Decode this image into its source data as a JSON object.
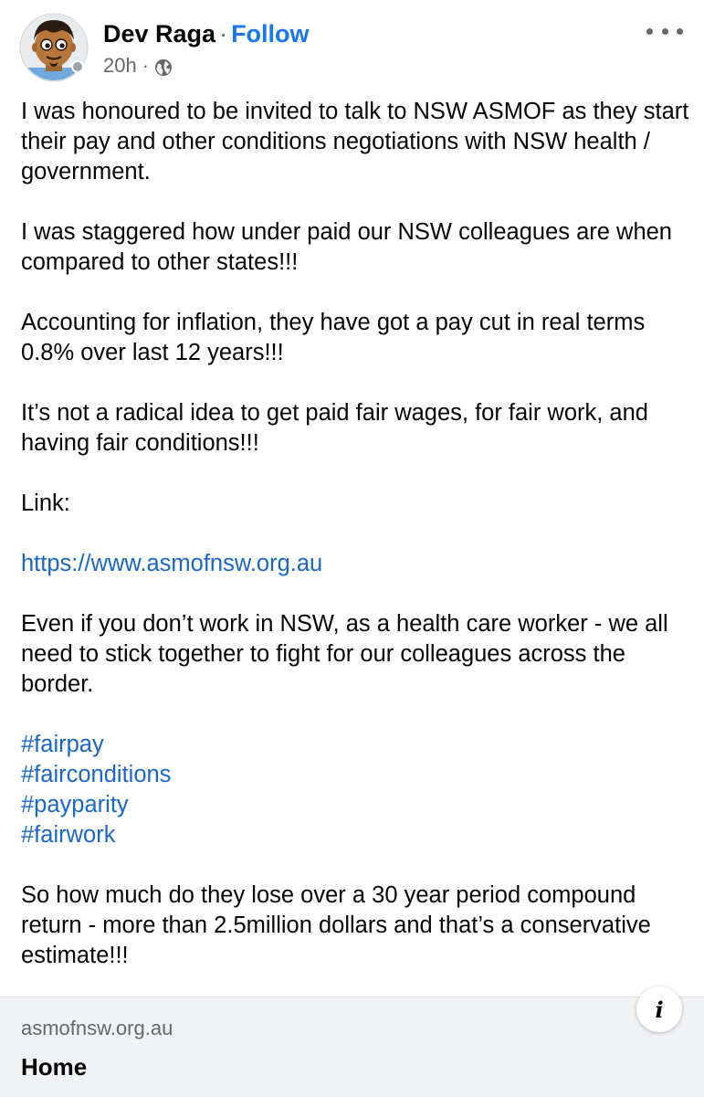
{
  "post": {
    "author": "Dev Raga",
    "separator": "·",
    "follow_label": "Follow",
    "timestamp": "20h",
    "meta_separator": "·",
    "privacy_icon": "globe-icon",
    "more_icon": "more-dots-icon",
    "paragraphs": [
      "I was honoured to be invited to talk to NSW ASMOF as they start their pay and other conditions negotiations with NSW health / government.",
      "I was staggered how under paid our NSW colleagues are when compared to other states!!!",
      "Accounting for inflation, they have got a pay cut in real terms 0.8% over last 12 years!!!",
      "It’s not a radical idea to get paid fair wages, for fair work, and having fair conditions!!!",
      "Link:",
      "Even if you don’t work in NSW, as a health care worker - we all need to stick together to fight for our colleagues across the border.",
      "So how much do they lose over a 30 year period compound return - more than 2.5million dollars and that’s a conservative estimate!!!"
    ],
    "link_url": "https://www.asmofnsw.org.au",
    "hashtags": [
      "#fairpay",
      "#fairconditions",
      "#payparity",
      "#fairwork"
    ]
  },
  "link_preview": {
    "domain": "asmofnsw.org.au",
    "title": "Home",
    "info_icon": "info-icon",
    "info_label": "i"
  },
  "colors": {
    "link_blue": "#1a66c9",
    "follow_blue": "#1877f2",
    "secondary_text": "#65676b",
    "card_background": "#f0f2f5"
  }
}
